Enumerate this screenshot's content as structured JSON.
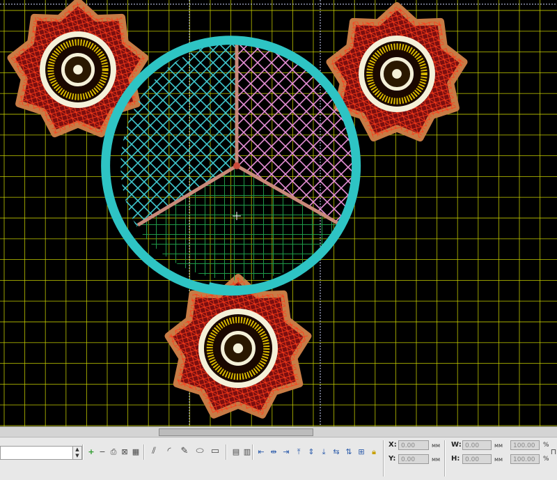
{
  "workspace": {
    "background": "#000000",
    "grid_color": "#c8d000",
    "colors": {
      "petal_outline": "#c77b45",
      "petal_fill": "#7a0f0f",
      "petal_stitch": "#ff3b1a",
      "center_ring": "#f4f0d8",
      "center_gold": "#d8b800",
      "circle_outline": "#2ec4c4",
      "segment_cyan": "#40c8d0",
      "segment_pink": "#e890d8",
      "segment_green": "#1f9a48",
      "divider": "#c98a7a"
    }
  },
  "toolbar": {
    "x_label": "X:",
    "y_label": "Y:",
    "w_label": "W:",
    "h_label": "H:",
    "x_value": "0.00",
    "y_value": "0.00",
    "w_value": "0.00",
    "h_value": "0.00",
    "w_pct": "100.00",
    "h_pct": "100.00",
    "unit_mm": "мм",
    "pct": "%"
  }
}
